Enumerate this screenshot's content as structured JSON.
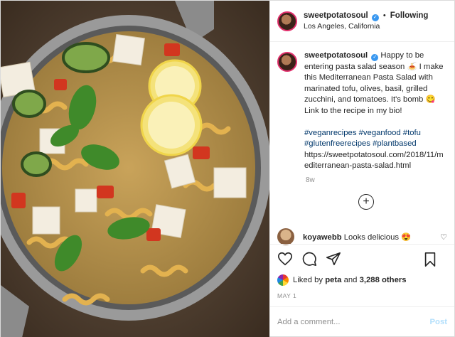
{
  "header": {
    "username": "sweetpotatosoul",
    "separator": "•",
    "follow_status": "Following",
    "location": "Los Angeles, California"
  },
  "caption": {
    "username": "sweetpotatosoul",
    "text": "Happy to be entering pasta salad season 🍝 I make this Mediterranean Pasta Salad with marinated tofu, olives, basil, grilled zucchini, and tomatoes. It's bomb 😋 Link to the recipe in my bio!",
    "hashtags": "#veganrecipes #veganfood #tofu #glutenfreerecipes #plantbased",
    "url": "https://sweetpotatosoul.com/2018/11/mediterranean-pasta-salad.html",
    "time": "8w"
  },
  "more_comments_icon": "plus-circle-icon",
  "comment": {
    "username": "koyawebb",
    "text": "Looks delicious 😍"
  },
  "actions": {
    "icons": [
      "heart-icon",
      "comment-icon",
      "share-icon",
      "bookmark-icon"
    ]
  },
  "likes": {
    "prefix": "Liked by",
    "user": "peta",
    "conjunction": "and",
    "others": "3,288 others"
  },
  "date": "MAY 1",
  "add_comment": {
    "placeholder": "Add a comment...",
    "post_label": "Post"
  },
  "colors": {
    "verified": "#3897f0",
    "link": "#00376b",
    "post_disabled": "#b2dffc",
    "story_ring": "#e1306c"
  }
}
